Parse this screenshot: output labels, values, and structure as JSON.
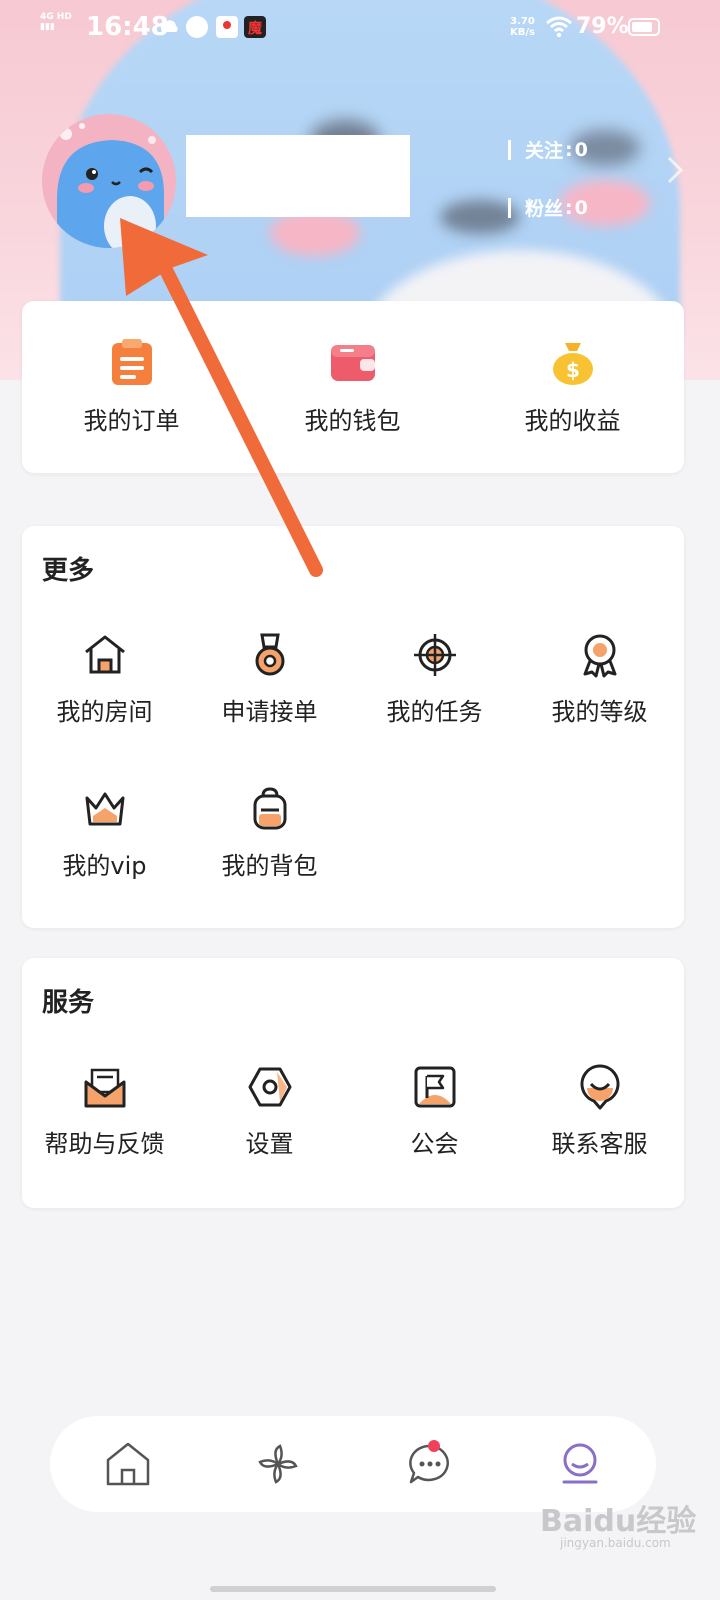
{
  "status_bar": {
    "network": "4G HD",
    "time": "16:48",
    "speed_value": "3.70",
    "speed_unit": "KB/s",
    "battery": "79%"
  },
  "profile": {
    "follow": {
      "label": "关注",
      "value": "0"
    },
    "fans": {
      "label": "粉丝",
      "value": "0"
    }
  },
  "quick_actions": [
    {
      "label": "我的订单",
      "icon": "order-icon"
    },
    {
      "label": "我的钱包",
      "icon": "wallet-icon"
    },
    {
      "label": "我的收益",
      "icon": "money-bag-icon"
    }
  ],
  "more": {
    "title": "更多",
    "items": [
      {
        "label": "我的房间",
        "icon": "house-icon"
      },
      {
        "label": "申请接单",
        "icon": "medal-icon"
      },
      {
        "label": "我的任务",
        "icon": "target-icon"
      },
      {
        "label": "我的等级",
        "icon": "badge-icon"
      },
      {
        "label": "我的vip",
        "icon": "crown-icon"
      },
      {
        "label": "我的背包",
        "icon": "backpack-icon"
      }
    ]
  },
  "services": {
    "title": "服务",
    "items": [
      {
        "label": "帮助与反馈",
        "icon": "mail-icon"
      },
      {
        "label": "设置",
        "icon": "settings-icon"
      },
      {
        "label": "公会",
        "icon": "flag-icon"
      },
      {
        "label": "联系客服",
        "icon": "smile-icon"
      }
    ]
  },
  "bottom_nav": [
    {
      "icon": "home-icon"
    },
    {
      "icon": "pinwheel-icon"
    },
    {
      "icon": "message-icon",
      "badge": true
    },
    {
      "icon": "profile-icon",
      "active": true
    }
  ],
  "colors": {
    "accent_orange": "#f5803e",
    "arrow": "#f06a3a",
    "active_tab": "#8a6fc8",
    "badge_red": "#f0405a"
  },
  "watermark": {
    "brand": "Baidu经验",
    "url": "jingyan.baidu.com"
  }
}
